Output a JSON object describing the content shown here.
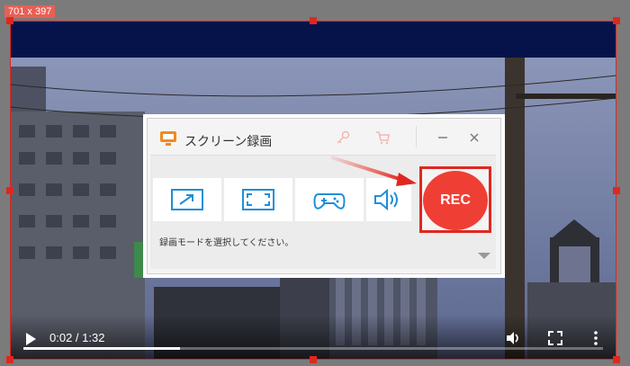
{
  "selection": {
    "dimensions_label": "701 x 397"
  },
  "video_player": {
    "time": "0:02 / 1:32",
    "progress_fraction": 0.27,
    "icons": {
      "play": "play-icon",
      "volume": "volume-icon",
      "fullscreen": "fullscreen-icon",
      "more": "more-vert-icon"
    }
  },
  "recorder": {
    "title": "スクリーン録画",
    "icons": {
      "logo": "monitor-logo-icon",
      "key": "key-icon",
      "cart": "cart-icon",
      "minimize": "minimize-icon",
      "close": "close-icon"
    },
    "modes": [
      {
        "name": "region",
        "icon": "region-select-icon"
      },
      {
        "name": "fullscreen",
        "icon": "fullscreen-capture-icon"
      },
      {
        "name": "game",
        "icon": "gamepad-icon"
      },
      {
        "name": "audio",
        "icon": "speaker-icon"
      }
    ],
    "status_text": "録画モードを選択してください。",
    "rec_label": "REC"
  },
  "colors": {
    "accent_red": "#e0271f",
    "rec_fill": "#ef3f35",
    "mode_icon_blue": "#1e8fd8",
    "video_top_strip": "#06124a"
  }
}
